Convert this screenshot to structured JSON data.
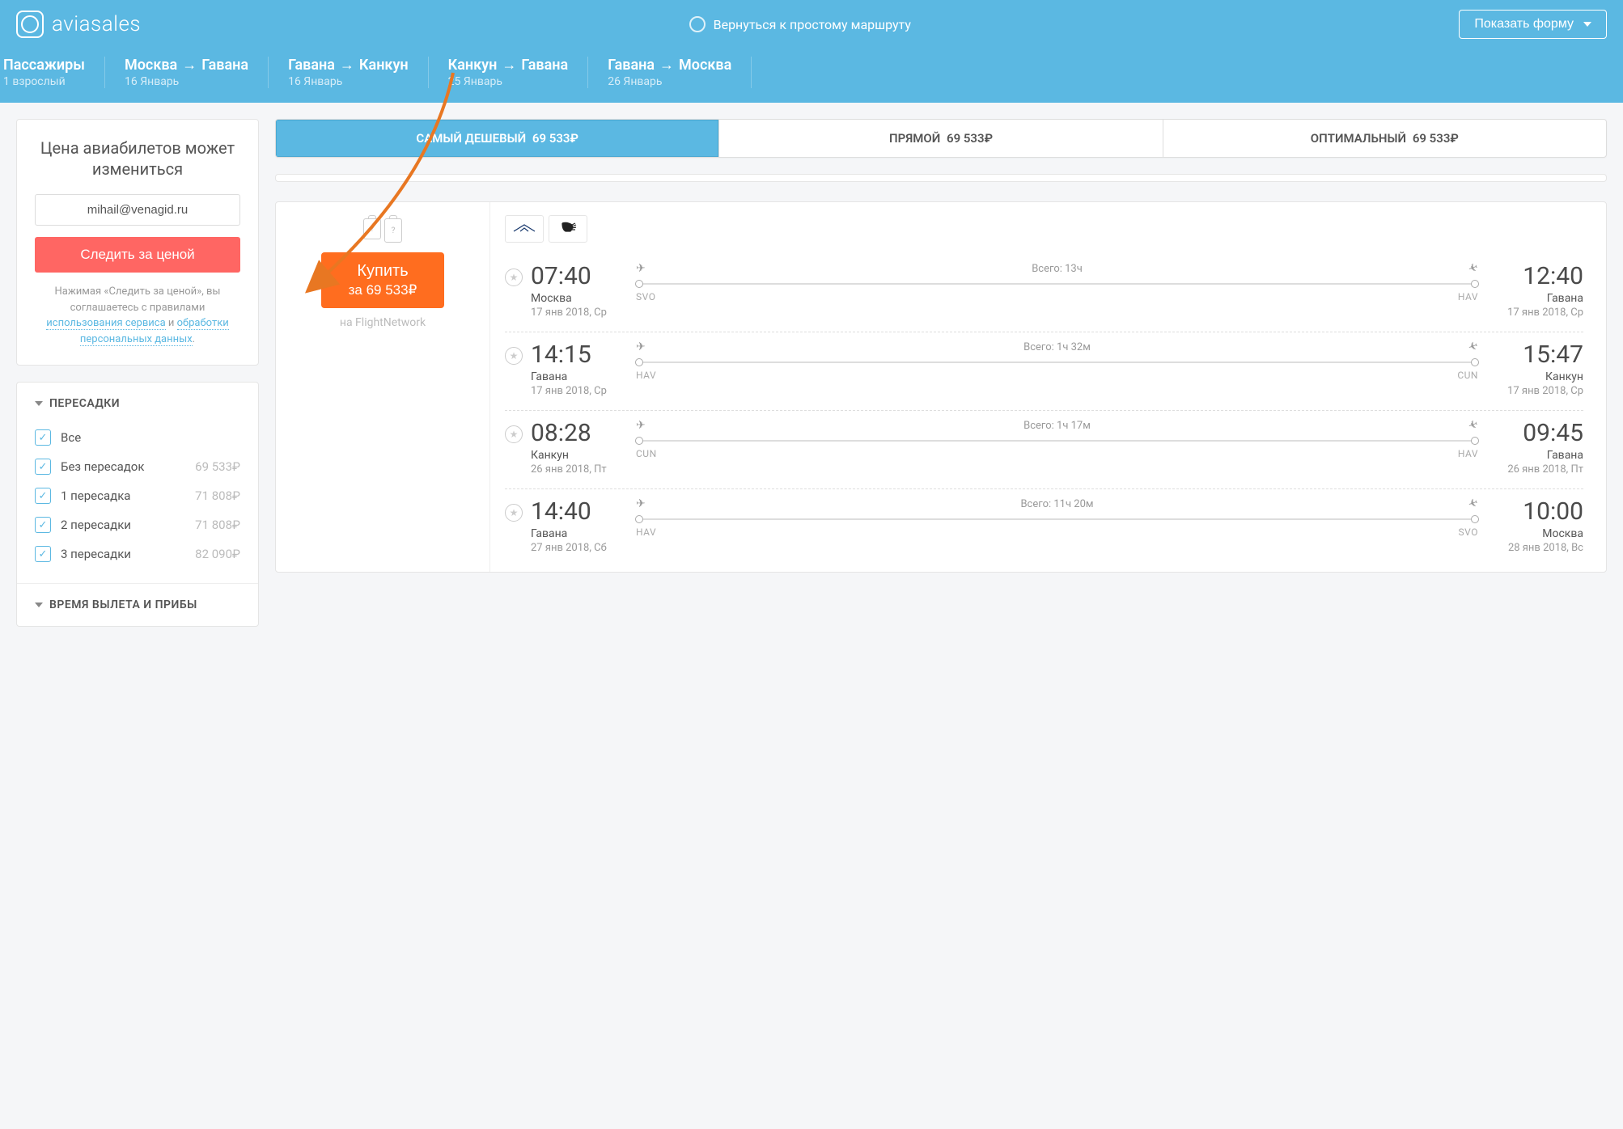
{
  "header": {
    "brand": "aviasales",
    "simple_route": "Вернуться к простому маршруту",
    "show_form": "Показать форму"
  },
  "route": {
    "passengers_label": "Пассажиры",
    "passengers_value": "1 взрослый",
    "legs": [
      {
        "from": "Москва",
        "to": "Гавана",
        "date": "16 Январь"
      },
      {
        "from": "Гавана",
        "to": "Канкун",
        "date": "16 Январь"
      },
      {
        "from": "Канкун",
        "to": "Гавана",
        "date": "25 Январь"
      },
      {
        "from": "Гавана",
        "to": "Москва",
        "date": "26 Январь"
      }
    ]
  },
  "subscribe": {
    "title": "Цена авиабилетов может измениться",
    "email": "mihail@venagid.ru",
    "track_btn": "Следить за ценой",
    "disclaimer_pre": "Нажимая «Следить за ценой», вы соглашаетесь с правилами ",
    "link1": "использования сервиса",
    "mid": " и ",
    "link2": "обработки персональных данных",
    "post": "."
  },
  "filters": {
    "transfers_title": "ПЕРЕСАДКИ",
    "departure_title": "ВРЕМЯ ВЫЛЕТА И ПРИБЫ",
    "options": [
      {
        "label": "Все",
        "price": ""
      },
      {
        "label": "Без пересадок",
        "price": "69 533₽"
      },
      {
        "label": "1 пересадка",
        "price": "71 808₽"
      },
      {
        "label": "2 пересадки",
        "price": "71 808₽"
      },
      {
        "label": "3 пересадки",
        "price": "82 090₽"
      }
    ]
  },
  "tabs": [
    {
      "label": "САМЫЙ ДЕШЕВЫЙ",
      "price": "69 533₽",
      "active": true
    },
    {
      "label": "ПРЯМОЙ",
      "price": "69 533₽",
      "active": false
    },
    {
      "label": "ОПТИМАЛЬНЫЙ",
      "price": "69 533₽",
      "active": false
    }
  ],
  "ticket": {
    "buy_label": "Купить",
    "buy_price": "за 69 533₽",
    "buy_source": "на FlightNetwork",
    "segments": [
      {
        "dep_time": "07:40",
        "dep_city": "Москва",
        "dep_date": "17 янв 2018, Ср",
        "duration": "Всего: 13ч",
        "dep_code": "SVO",
        "arr_code": "HAV",
        "arr_time": "12:40",
        "arr_city": "Гавана",
        "arr_date": "17 янв 2018, Ср"
      },
      {
        "dep_time": "14:15",
        "dep_city": "Гавана",
        "dep_date": "17 янв 2018, Ср",
        "duration": "Всего: 1ч 32м",
        "dep_code": "HAV",
        "arr_code": "CUN",
        "arr_time": "15:47",
        "arr_city": "Канкун",
        "arr_date": "17 янв 2018, Ср"
      },
      {
        "dep_time": "08:28",
        "dep_city": "Канкун",
        "dep_date": "26 янв 2018, Пт",
        "duration": "Всего: 1ч 17м",
        "dep_code": "CUN",
        "arr_code": "HAV",
        "arr_time": "09:45",
        "arr_city": "Гавана",
        "arr_date": "26 янв 2018, Пт"
      },
      {
        "dep_time": "14:40",
        "dep_city": "Гавана",
        "dep_date": "27 янв 2018, Сб",
        "duration": "Всего: 11ч 20м",
        "dep_code": "HAV",
        "arr_code": "SVO",
        "arr_time": "10:00",
        "arr_city": "Москва",
        "arr_date": "28 янв 2018, Вс"
      }
    ]
  }
}
